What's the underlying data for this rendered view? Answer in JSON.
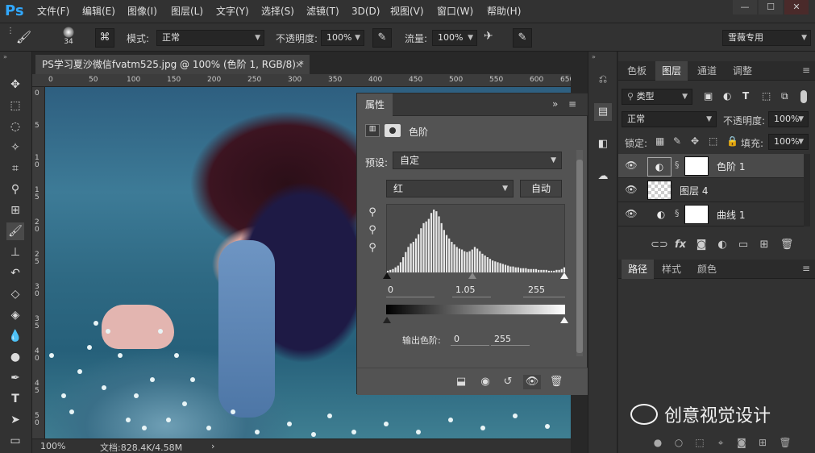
{
  "app": {
    "logo": "Ps"
  },
  "menu": [
    "文件(F)",
    "编辑(E)",
    "图像(I)",
    "图层(L)",
    "文字(Y)",
    "选择(S)",
    "滤镜(T)",
    "3D(D)",
    "视图(V)",
    "窗口(W)",
    "帮助(H)"
  ],
  "window_controls": {
    "min": "—",
    "max": "☐",
    "close": "✕"
  },
  "options": {
    "brush_size": "34",
    "mode_label": "模式:",
    "mode_value": "正常",
    "opacity_label": "不透明度:",
    "opacity_value": "100%",
    "flow_label": "流量:",
    "flow_value": "100%",
    "workspace": "雪薇专用"
  },
  "document": {
    "tab_title": "PS学习夏沙微信fvatm525.jpg @ 100% (色阶 1, RGB/8) *",
    "tab_close": "×",
    "ruler_h": [
      "0",
      "50",
      "100",
      "150",
      "200",
      "250",
      "300",
      "350",
      "400",
      "450",
      "500",
      "550",
      "600",
      "650"
    ],
    "ruler_v": [
      "0",
      "5",
      "1\n0",
      "1\n5",
      "2\n0",
      "2\n5",
      "3\n0",
      "3\n5",
      "4\n0",
      "4\n5",
      "5\n0"
    ],
    "zoom": "100%",
    "doc_info": "文档:828.4K/4.58M",
    "arrow": "›"
  },
  "properties": {
    "tab": "属性",
    "type_label": "色阶",
    "preset_label": "预设:",
    "preset_value": "自定",
    "channel_value": "红",
    "auto_label": "自动",
    "input_black": "0",
    "input_gamma": "1.05",
    "input_white": "255",
    "output_label": "输出色阶:",
    "output_black": "0",
    "output_white": "255",
    "histogram_levels": [
      2,
      3,
      4,
      6,
      8,
      12,
      18,
      24,
      30,
      34,
      36,
      40,
      45,
      52,
      58,
      60,
      63,
      70,
      74,
      72,
      66,
      58,
      50,
      44,
      40,
      36,
      33,
      30,
      28,
      27,
      25,
      24,
      25,
      27,
      30,
      28,
      25,
      22,
      20,
      18,
      16,
      14,
      13,
      12,
      11,
      10,
      9,
      8,
      7,
      7,
      6,
      6,
      5,
      5,
      5,
      4,
      4,
      4,
      4,
      3,
      3,
      3,
      3,
      2,
      2,
      2,
      3,
      3,
      4,
      6
    ]
  },
  "right_tabs": {
    "top": [
      "色板",
      "图层",
      "通道",
      "调整"
    ],
    "top_active": "图层",
    "bottom": [
      "路径",
      "样式",
      "颜色"
    ],
    "bottom_active": "路径"
  },
  "layers_panel": {
    "kind_filter": "类型",
    "blend_mode": "正常",
    "opacity_label": "不透明度:",
    "opacity_value": "100%",
    "lock_label": "锁定:",
    "fill_label": "填充:",
    "fill_value": "100%",
    "layers": [
      {
        "name": "色阶 1",
        "kind": "levels",
        "selected": true
      },
      {
        "name": "图层 4",
        "kind": "pixel",
        "selected": false
      },
      {
        "name": "曲线 1",
        "kind": "curves",
        "selected": false
      }
    ]
  },
  "watermark": "创意视觉设计"
}
